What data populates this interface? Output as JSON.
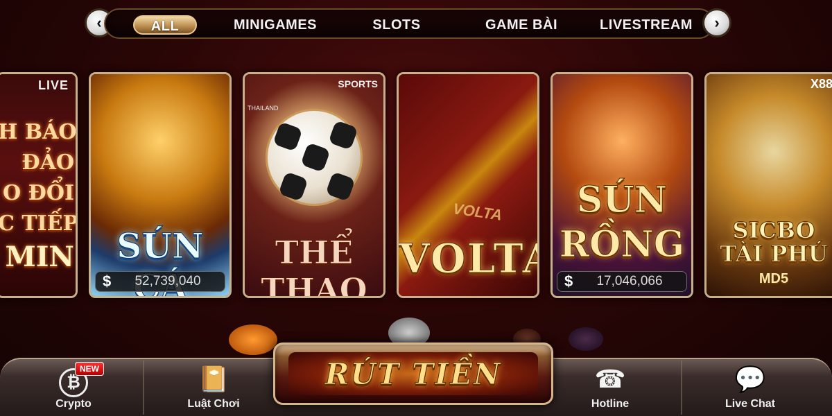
{
  "nav": {
    "tabs": [
      {
        "label": "ALL",
        "active": true
      },
      {
        "label": "MINIGAMES",
        "active": false
      },
      {
        "label": "SLOTS",
        "active": false
      },
      {
        "label": "GAME BÀI",
        "active": false
      },
      {
        "label": "LIVESTREAM",
        "active": false
      }
    ],
    "prev_icon": "chevron-left-icon",
    "next_icon": "chevron-right-icon"
  },
  "cards": [
    {
      "badge": "LIVE",
      "lines": [
        "H BÁO",
        "ĐẢO",
        "O ĐỔI",
        "C TIẾP",
        "MIN"
      ]
    },
    {
      "title": "SÚN CÁ",
      "currency": "$",
      "jackpot": "52,739,040"
    },
    {
      "title": "THỂ THAO",
      "brand": "SPORTS",
      "sub": "THAILAND"
    },
    {
      "title": "VOLTA",
      "sub": "VOLTA"
    },
    {
      "title_line1": "SÚN",
      "title_line2": "RỒNG",
      "currency": "$",
      "jackpot": "17,046,066"
    },
    {
      "badge": "X88",
      "title_line1": "SICBO",
      "title_line2": "TÀI PHÚ",
      "sub": "MD5"
    }
  ],
  "bottom": {
    "crypto": {
      "label": "Crypto",
      "badge": "NEW",
      "icon": "bitcoin-icon"
    },
    "rules": {
      "label": "Luật Chơi",
      "icon": "rulebook-icon"
    },
    "withdraw": {
      "label": "RÚT TIỀN"
    },
    "hotline": {
      "label": "Hotline",
      "icon": "telephone-icon"
    },
    "livechat": {
      "label": "Live Chat",
      "icon": "chat-bubbles-icon"
    }
  },
  "colors": {
    "background": "#2a0606",
    "accent_gold": "#e9c98f",
    "nav_active": "#b88a4c"
  }
}
